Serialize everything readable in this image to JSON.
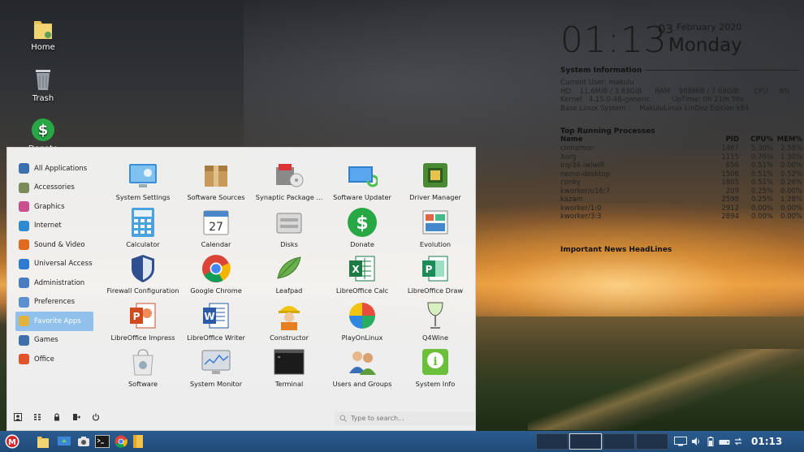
{
  "desktop": {
    "icons": [
      {
        "label": "Home"
      },
      {
        "label": "Trash"
      },
      {
        "label": "Donate"
      }
    ]
  },
  "conky": {
    "time": "01:13",
    "day": "03",
    "month_year": "February 2020",
    "weekday": "Monday",
    "system_info_title": "System Information",
    "lines": [
      "Current User: makulu",
      "HD    11.6MiB / 3.83GiB      RAM    988MiB / 7.69GiB       CPU     6%",
      "Kernel   4.15.0-46-generic          UpTime: 0h 21m 56s",
      "Base Linux System :    MakuluLinux LinDoz Edition x64"
    ],
    "processes_title": "Top Running Processes",
    "process_headers": [
      "Name",
      "PID",
      "CPU%",
      "MEM%"
    ],
    "processes": [
      [
        "cinnamon",
        "1467",
        "5.30%",
        "2.58%"
      ],
      [
        "Xorg",
        "1115",
        "0.76%",
        "1.30%"
      ],
      [
        "irq/34-iwlwifi",
        "656",
        "0.51%",
        "0.00%"
      ],
      [
        "nemo-desktop",
        "1506",
        "0.51%",
        "0.52%"
      ],
      [
        "conky",
        "1805",
        "0.51%",
        "0.26%"
      ],
      [
        "kworker/u16:7",
        "209",
        "0.25%",
        "0.00%"
      ],
      [
        "kazam",
        "2598",
        "0.25%",
        "1.28%"
      ],
      [
        "kworker/1:0",
        "2912",
        "0.00%",
        "0.00%"
      ],
      [
        "kworker/3:3",
        "2894",
        "0.00%",
        "0.00%"
      ]
    ],
    "news_title": "Important News HeadLines"
  },
  "menu": {
    "categories": [
      {
        "label": "All Applications",
        "color": "#3b6fb0"
      },
      {
        "label": "Accessories",
        "color": "#7a8a5a"
      },
      {
        "label": "Graphics",
        "color": "#c94f8e"
      },
      {
        "label": "Internet",
        "color": "#2e8bd1"
      },
      {
        "label": "Sound & Video",
        "color": "#e06a1e"
      },
      {
        "label": "Universal Access",
        "color": "#2e7bd1"
      },
      {
        "label": "Administration",
        "color": "#4a7cc2"
      },
      {
        "label": "Preferences",
        "color": "#5b8fd0"
      },
      {
        "label": "Favorite Apps",
        "color": "#e3b23c"
      },
      {
        "label": "Games",
        "color": "#3f6fa8"
      },
      {
        "label": "Office",
        "color": "#e0532b"
      }
    ],
    "active_category": "Favorite Apps",
    "apps": [
      {
        "label": "System Settings",
        "icon": "system-settings-icon"
      },
      {
        "label": "Software Sources",
        "icon": "software-sources-icon"
      },
      {
        "label": "Synaptic Package ...",
        "icon": "synaptic-icon"
      },
      {
        "label": "Software Updater",
        "icon": "software-updater-icon"
      },
      {
        "label": "Driver Manager",
        "icon": "driver-manager-icon"
      },
      {
        "label": "Calculator",
        "icon": "calculator-icon"
      },
      {
        "label": "Calendar",
        "icon": "calendar-icon",
        "badge": "27"
      },
      {
        "label": "Disks",
        "icon": "disks-icon"
      },
      {
        "label": "Donate",
        "icon": "donate-icon"
      },
      {
        "label": "Evolution",
        "icon": "evolution-icon"
      },
      {
        "label": "Firewall Configuration",
        "icon": "firewall-icon"
      },
      {
        "label": "Google Chrome",
        "icon": "chrome-icon"
      },
      {
        "label": "Leafpad",
        "icon": "leafpad-icon"
      },
      {
        "label": "LibreOffice Calc",
        "icon": "calc-icon",
        "badge": "X"
      },
      {
        "label": "LibreOffice Draw",
        "icon": "draw-icon",
        "badge": "P"
      },
      {
        "label": "LibreOffice Impress",
        "icon": "impress-icon",
        "badge": "P"
      },
      {
        "label": "LibreOffice Writer",
        "icon": "writer-icon",
        "badge": "W"
      },
      {
        "label": "Constructor",
        "icon": "constructor-icon"
      },
      {
        "label": "PlayOnLinux",
        "icon": "playonlinux-icon"
      },
      {
        "label": "Q4Wine",
        "icon": "q4wine-icon"
      },
      {
        "label": "Software",
        "icon": "software-icon"
      },
      {
        "label": "System Monitor",
        "icon": "system-monitor-icon"
      },
      {
        "label": "Terminal",
        "icon": "terminal-icon"
      },
      {
        "label": "Users and Groups",
        "icon": "users-groups-icon"
      },
      {
        "label": "System Info",
        "icon": "system-info-icon"
      }
    ],
    "search_placeholder": "Type to search..."
  },
  "taskbar": {
    "clock": "01:13"
  }
}
